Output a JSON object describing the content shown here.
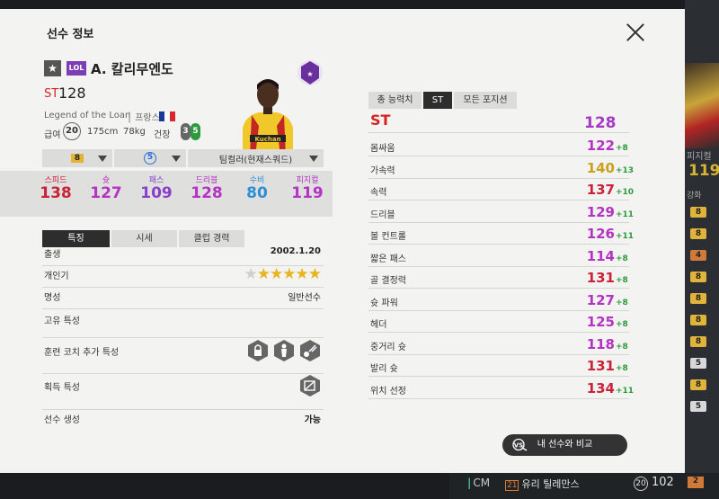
{
  "background": {
    "right_ovr": "119",
    "right_label": "피지컬",
    "right_label2": "강화",
    "right_chips": [
      "8",
      "8",
      "4",
      "8",
      "8",
      "8",
      "8",
      "5",
      "8",
      "5"
    ],
    "bottom": {
      "pos": "CM",
      "season": "21",
      "name": "유리 틸레만스",
      "pay": "20",
      "ovr": "102",
      "level": "2"
    }
  },
  "modal": {
    "title": "선수 정보",
    "close_icon": "close-icon"
  },
  "player": {
    "season_tag": "LOL",
    "name": "A. 칼리무엔도",
    "position": "ST",
    "position_ovr": "128",
    "series": "Legend of the Loan",
    "nation": "프랑스",
    "pay_label": "급여",
    "pay": "20",
    "height": "175cm",
    "weight": "78kg",
    "body_label": "건장",
    "foot_left": "3",
    "foot_right": "5"
  },
  "selectors": {
    "level": "8",
    "enhance": "5",
    "team_color": "팀컬러(현재스쿼드)"
  },
  "summary_stats": [
    {
      "label": "스피드",
      "value": "138",
      "color": "#c8233a"
    },
    {
      "label": "슛",
      "value": "127",
      "color": "#b433c4"
    },
    {
      "label": "패스",
      "value": "109",
      "color": "#8a41c9"
    },
    {
      "label": "드리블",
      "value": "128",
      "color": "#b433c4"
    },
    {
      "label": "수비",
      "value": "80",
      "color": "#2d8ed6"
    },
    {
      "label": "피지컬",
      "value": "119",
      "color": "#b433c4"
    }
  ],
  "left_tabs": [
    "특징",
    "시세",
    "클럽 경력"
  ],
  "info": {
    "birth_label": "출생",
    "birth": "2002.1.20",
    "popularity_label": "개인기",
    "popularity_stars": 5,
    "fame_label": "명성",
    "fame": "일반선수",
    "unique_trait_label": "고유 특성",
    "coach_trait_label": "훈련 코치 추가 특성",
    "acquired_trait_label": "획득 특성",
    "create_label": "선수 생성",
    "create": "가능"
  },
  "right_tabs": [
    "총 능력치",
    "ST",
    "모든 포지션"
  ],
  "overall": {
    "label": "ST",
    "value": "128"
  },
  "detail_stats": [
    {
      "label": "몸싸움",
      "value": "122",
      "bonus": "+8",
      "color": "#b433c4"
    },
    {
      "label": "가속력",
      "value": "140",
      "bonus": "+13",
      "color": "#c9a11d"
    },
    {
      "label": "속력",
      "value": "137",
      "bonus": "+10",
      "color": "#c8233a"
    },
    {
      "label": "드리블",
      "value": "129",
      "bonus": "+11",
      "color": "#b433c4"
    },
    {
      "label": "볼 컨트롤",
      "value": "126",
      "bonus": "+11",
      "color": "#b433c4"
    },
    {
      "label": "짧은 패스",
      "value": "114",
      "bonus": "+8",
      "color": "#b433c4"
    },
    {
      "label": "골 결정력",
      "value": "131",
      "bonus": "+8",
      "color": "#c8233a"
    },
    {
      "label": "슛 파워",
      "value": "127",
      "bonus": "+8",
      "color": "#b433c4"
    },
    {
      "label": "헤더",
      "value": "125",
      "bonus": "+8",
      "color": "#b433c4"
    },
    {
      "label": "중거리 슛",
      "value": "118",
      "bonus": "+8",
      "color": "#b433c4"
    },
    {
      "label": "발리 슛",
      "value": "131",
      "bonus": "+8",
      "color": "#c8233a"
    },
    {
      "label": "위치 선정",
      "value": "134",
      "bonus": "+11",
      "color": "#c8233a"
    }
  ],
  "compare_button": "내 선수와 비교"
}
